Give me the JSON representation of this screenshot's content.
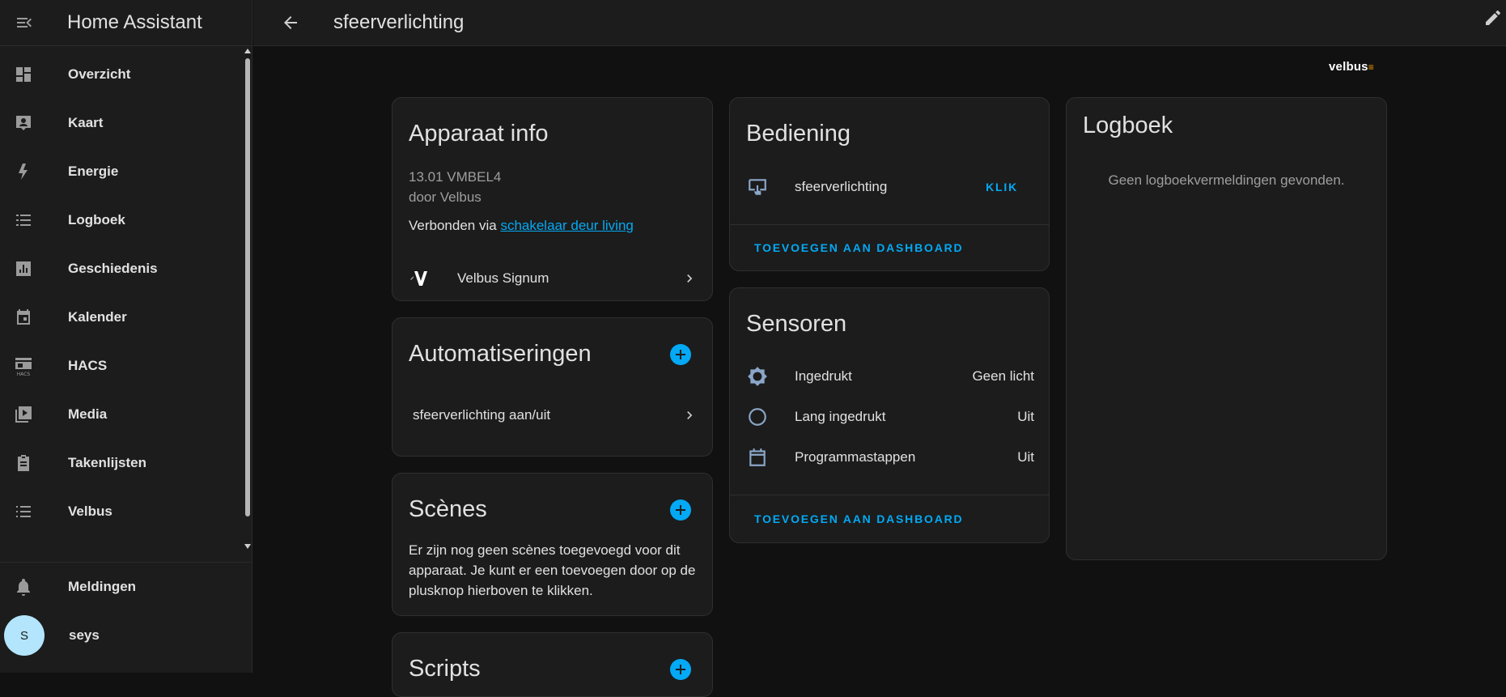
{
  "app": {
    "title": "Home Assistant"
  },
  "sidebar": {
    "items": [
      {
        "label": "Overzicht",
        "icon": "dashboard-icon"
      },
      {
        "label": "Kaart",
        "icon": "map-icon"
      },
      {
        "label": "Energie",
        "icon": "lightning-icon"
      },
      {
        "label": "Logboek",
        "icon": "logbook-icon"
      },
      {
        "label": "Geschiedenis",
        "icon": "chart-icon"
      },
      {
        "label": "Kalender",
        "icon": "calendar-icon"
      },
      {
        "label": "HACS",
        "icon": "hacs-icon"
      },
      {
        "label": "Media",
        "icon": "media-icon"
      },
      {
        "label": "Takenlijsten",
        "icon": "clipboard-icon"
      },
      {
        "label": "Velbus",
        "icon": "list-icon"
      }
    ],
    "notifications": "Meldingen",
    "user": {
      "name": "seys",
      "initial": "S"
    }
  },
  "topbar": {
    "title": "sfeerverlichting"
  },
  "brand": {
    "logo_text": "velbus"
  },
  "device_info": {
    "title": "Apparaat info",
    "model": "13.01 VMBEL4",
    "manufacturer": "door Velbus",
    "connected_prefix": "Verbonden via",
    "connected_link": "schakelaar deur living",
    "integration": "Velbus Signum"
  },
  "automations": {
    "title": "Automatiseringen",
    "items": [
      "sfeerverlichting aan/uit"
    ]
  },
  "scenes": {
    "title": "Scènes",
    "empty_text": "Er zijn nog geen scènes toegevoegd voor dit apparaat. Je kunt er een toevoegen door op de plusknop hierboven te klikken."
  },
  "scripts": {
    "title": "Scripts"
  },
  "controls": {
    "title": "Bediening",
    "entity": "sfeerverlichting",
    "action": "KLIK",
    "add_to_dashboard": "TOEVOEGEN AAN DASHBOARD"
  },
  "sensors": {
    "title": "Sensoren",
    "items": [
      {
        "name": "Ingedrukt",
        "state": "Geen licht"
      },
      {
        "name": "Lang ingedrukt",
        "state": "Uit"
      },
      {
        "name": "Programmastappen",
        "state": "Uit"
      }
    ],
    "add_to_dashboard": "TOEVOEGEN AAN DASHBOARD"
  },
  "logbook": {
    "title": "Logboek",
    "empty_text": "Geen logboekvermeldingen gevonden."
  },
  "colors": {
    "accent": "#03a9f4",
    "card": "#1c1c1c",
    "background": "#111111"
  }
}
